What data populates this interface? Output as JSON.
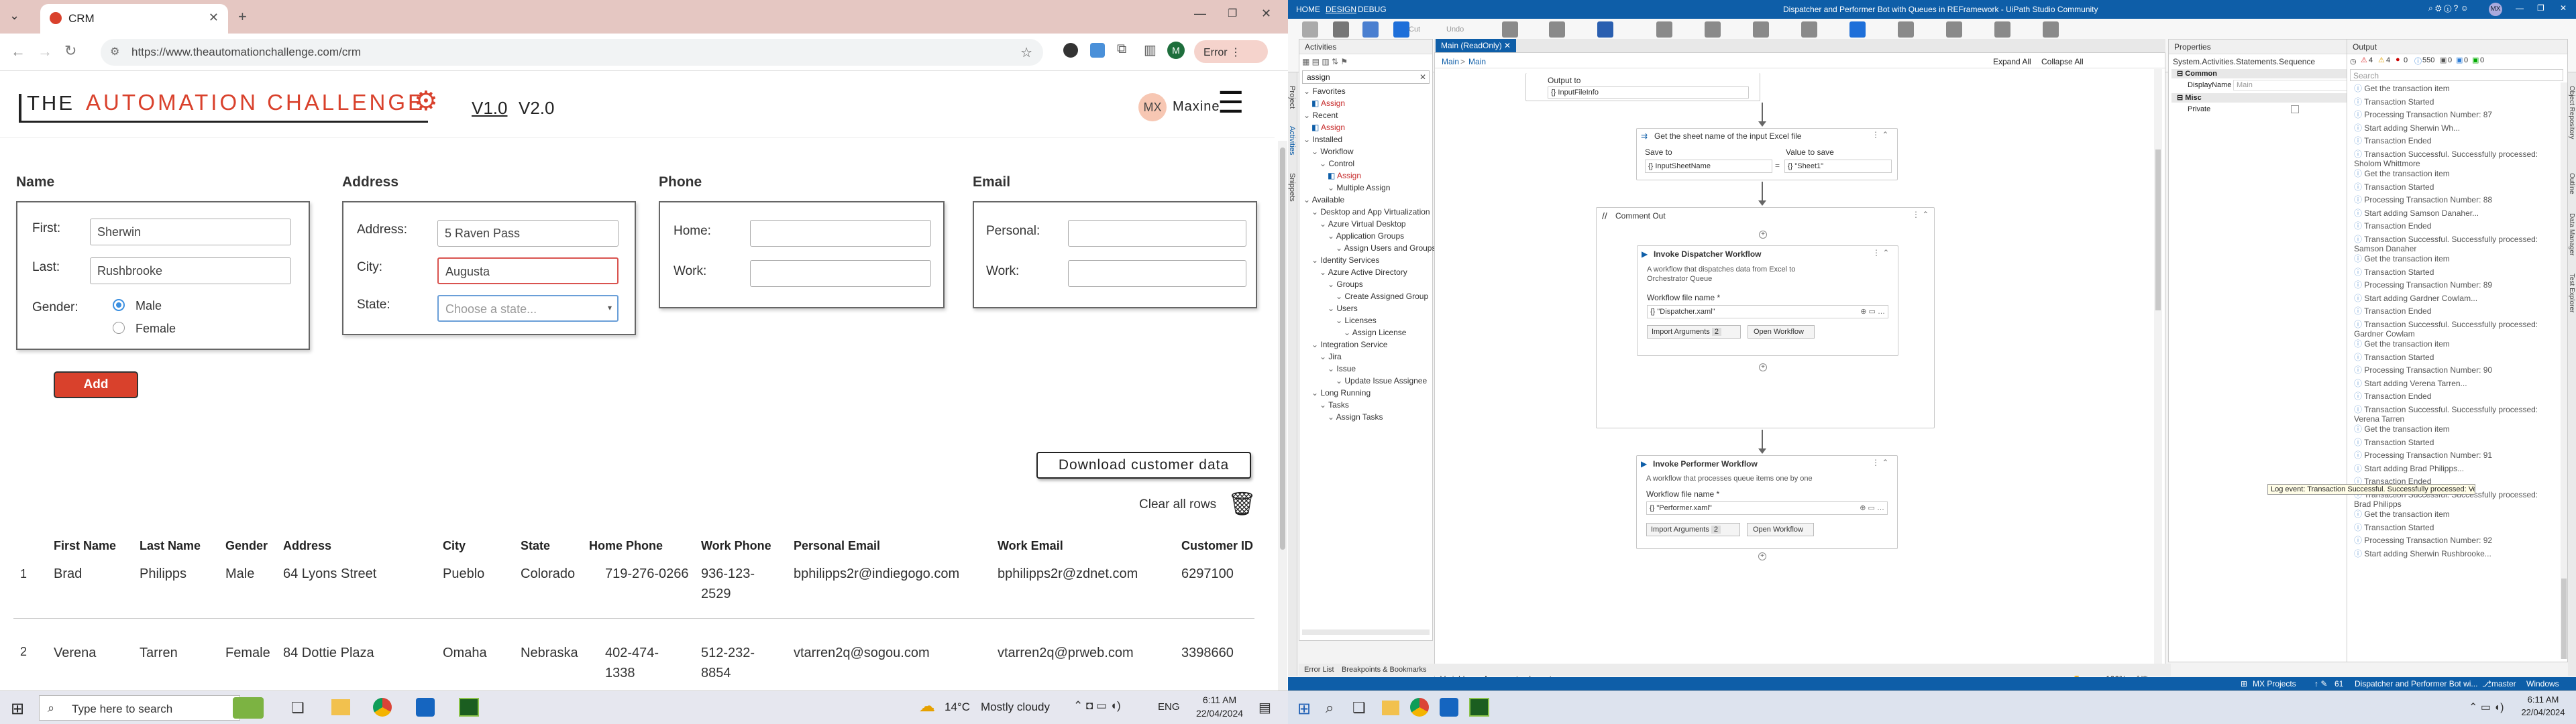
{
  "browser": {
    "tab_title": "CRM",
    "url": "https://www.theautomationchallenge.com/crm",
    "error_label": "Error",
    "profile_initial": "M",
    "icons": {
      "page_icon": "chili-icon",
      "new_tab": "plus-icon"
    }
  },
  "crm": {
    "brand_the": "THE",
    "brand_name": "AUTOMATION CHALLENGE",
    "version_1": "V1.0",
    "version_2": "V2.0",
    "user_initials": "MX",
    "user_name": "Maxine",
    "sections": {
      "name": "Name",
      "address": "Address",
      "phone": "Phone",
      "email": "Email"
    },
    "labels": {
      "first": "First:",
      "last": "Last:",
      "gender": "Gender:",
      "male": "Male",
      "female": "Female",
      "address": "Address:",
      "city": "City:",
      "state": "State:",
      "home": "Home:",
      "work": "Work:",
      "personal": "Personal:",
      "work_email": "Work:"
    },
    "values": {
      "first": "Sherwin",
      "last": "Rushbrooke",
      "address": "5 Raven Pass",
      "city": "Augusta",
      "state_placeholder": "Choose a state...",
      "home": "",
      "work": "",
      "personal": "",
      "work_email": ""
    },
    "add_button": "Add",
    "download_button": "Download customer data",
    "clear_rows": "Clear all rows",
    "table": {
      "columns": [
        "First Name",
        "Last Name",
        "Gender",
        "Address",
        "City",
        "State",
        "Home Phone",
        "Work Phone",
        "Personal Email",
        "Work Email",
        "Customer ID"
      ],
      "rows": [
        {
          "num": "1",
          "first": "Brad",
          "last": "Philipps",
          "gender": "Male",
          "address": "64 Lyons Street",
          "city": "Pueblo",
          "state": "Colorado",
          "home": "719-276-0266",
          "work": "936-123-\n2529",
          "personal": "bphilipps2r@indiegogo.com",
          "work_email": "bphilipps2r@zdnet.com",
          "id": "6297100"
        },
        {
          "num": "2",
          "first": "Verena",
          "last": "Tarren",
          "gender": "Female",
          "address": "84 Dottie Plaza",
          "city": "Omaha",
          "state": "Nebraska",
          "home": "402-474-\n1338",
          "work": "512-232-\n8854",
          "personal": "vtarren2q@sogou.com",
          "work_email": "vtarren2q@prweb.com",
          "id": "3398660"
        }
      ]
    }
  },
  "taskbar_left": {
    "search_placeholder": "Type here to search",
    "weather_temp": "14°C",
    "weather_desc": "Mostly cloudy",
    "lang": "ENG",
    "time": "6:11 AM",
    "date": "22/04/2024"
  },
  "studio": {
    "menu": [
      "HOME",
      "DESIGN",
      "DEBUG"
    ],
    "title": "Dispatcher and Performer Bot with Queues in REFramework - UiPath Studio Community",
    "ribbon": [
      {
        "label": "New"
      },
      {
        "label": "Save"
      },
      {
        "label": "Export\nAs"
      },
      {
        "label": "Stop"
      },
      {
        "label": "Manage\nPackages"
      },
      {
        "label": "Manage\nEntities"
      },
      {
        "label": "Test\nManager"
      },
      {
        "label": "App/Web\nRecorder"
      },
      {
        "label": "Computer\nVision"
      },
      {
        "label": "User\nEvents"
      },
      {
        "label": "Table\nExtraction"
      },
      {
        "label": "UI\nExplorer"
      },
      {
        "label": "Remove\nUnused"
      },
      {
        "label": "Analyze\nFile"
      },
      {
        "label": "Export\nto Excel"
      },
      {
        "label": "Publish"
      }
    ],
    "ribbon_small": [
      "Cut",
      "Copy",
      "Paste",
      "Undo",
      "Redo"
    ],
    "activities": {
      "title": "Activities",
      "search": "assign",
      "rows": [
        {
          "t": "Favorites",
          "lv": 0
        },
        {
          "t": "Assign",
          "lv": 1,
          "red": true
        },
        {
          "t": "Recent",
          "lv": 0
        },
        {
          "t": "Assign",
          "lv": 1,
          "red": true
        },
        {
          "t": "Installed",
          "lv": 0
        },
        {
          "t": "Workflow",
          "lv": 1
        },
        {
          "t": "Control",
          "lv": 2
        },
        {
          "t": "Assign",
          "lv": 3,
          "red": true
        },
        {
          "t": "Multiple Assign",
          "lv": 3
        },
        {
          "t": "Available",
          "lv": 0
        },
        {
          "t": "Desktop and App Virtualization",
          "lv": 1
        },
        {
          "t": "Azure Virtual Desktop",
          "lv": 2
        },
        {
          "t": "Application Groups",
          "lv": 3
        },
        {
          "t": "Assign Users and Groups to Applic",
          "lv": 4
        },
        {
          "t": "Identity Services",
          "lv": 1
        },
        {
          "t": "Azure Active Directory",
          "lv": 2
        },
        {
          "t": "Groups",
          "lv": 3
        },
        {
          "t": "Create Assigned Group",
          "lv": 4
        },
        {
          "t": "Users",
          "lv": 3
        },
        {
          "t": "Licenses",
          "lv": 4
        },
        {
          "t": "Assign License",
          "lv": 5
        },
        {
          "t": "Integration Service",
          "lv": 1
        },
        {
          "t": "Jira",
          "lv": 2
        },
        {
          "t": "Issue",
          "lv": 3
        },
        {
          "t": "Update Issue Assignee",
          "lv": 4
        },
        {
          "t": "Long Running",
          "lv": 1
        },
        {
          "t": "Tasks",
          "lv": 2
        },
        {
          "t": "Assign Tasks",
          "lv": 3
        }
      ]
    },
    "designer": {
      "tab": "Main (ReadOnly)",
      "breadcrumb": [
        "Main",
        "Main"
      ],
      "expand_all": "Expand All",
      "collapse_all": "Collapse All",
      "output_to": "Output to",
      "output_var": "InputFileInfo",
      "get_sheet": "Get the sheet name of the input Excel file",
      "save_to": "Save to",
      "value_to_save": "Value to save",
      "sheet_var": "InputSheetName",
      "sheet_val": "\"Sheet1\"",
      "comment_out": "Comment Out",
      "invoke_dispatcher": "Invoke Dispatcher Workflow",
      "dispatcher_desc": "A workflow that dispatches data from Excel to Orchestrator Queue",
      "wf_file_name": "Workflow file name *",
      "dispatcher_file": "\"Dispatcher.xaml\"",
      "import_args": "Import Arguments",
      "import_count": "2",
      "open_workflow": "Open Workflow",
      "invoke_performer": "Invoke Performer Workflow",
      "performer_desc": "A workflow that processes queue items one by one",
      "performer_file": "\"Performer.xaml\"",
      "bottom_tabs": [
        "Variables",
        "Arguments",
        "Imports"
      ],
      "zoom": "100%"
    },
    "properties": {
      "title": "Properties",
      "type": "System.Activities.Statements.Sequence",
      "common": "Common",
      "display_name_label": "DisplayName",
      "display_name_value": "Main",
      "misc": "Misc",
      "private_label": "Private"
    },
    "output": {
      "title": "Output",
      "counts": [
        "4",
        "4",
        "0",
        "550",
        "0",
        "0",
        "0"
      ],
      "search": "Search",
      "lines": [
        "Get the transaction item",
        "Transaction Started",
        "Processing Transaction Number: 87",
        "Start adding Sherwin Wh...",
        "Transaction Ended",
        "Transaction Successful. Successfully processed: Sholom Whittmore",
        "Get the transaction item",
        "Transaction Started",
        "Processing Transaction Number: 88",
        "Start adding Samson Danaher...",
        "Transaction Ended",
        "Transaction Successful. Successfully processed: Samson Danaher",
        "Get the transaction item",
        "Transaction Started",
        "Processing Transaction Number: 89",
        "Start adding Gardner Cowlam...",
        "Transaction Ended",
        "Transaction Successful. Successfully processed: Gardner Cowlam",
        "Get the transaction item",
        "Transaction Started",
        "Processing Transaction Number: 90",
        "Start adding Verena Tarren...",
        "Transaction Ended",
        "Transaction Successful. Successfully processed: Verena Tarren",
        "Get the transaction item",
        "Transaction Started",
        "Processing Transaction Number: 91",
        "Start adding Brad Philipps...",
        "Transaction Ended",
        "Transaction Successful. Successfully processed: Brad Philipps",
        "Get the transaction item",
        "Transaction Started",
        "Processing Transaction Number: 92",
        "Start adding Sherwin Rushbrooke..."
      ],
      "tooltip": "Log event: Transaction Successful. Successfully processed: Verena Tarren"
    },
    "side_tabs_left": [
      "Project",
      "Activities",
      "Snippets"
    ],
    "side_tabs_right": [
      "Object Repository",
      "Outline",
      "Data Manager",
      "Test Explorer"
    ],
    "bottom_left_tabs": [
      "Error List",
      "Breakpoints & Bookmarks"
    ],
    "status": {
      "project": "MX Projects",
      "counts": "61",
      "repo": "Dispatcher and Performer Bot wi...",
      "branch": "master",
      "platform": "Windows"
    },
    "taskbar_time": "6:11 AM",
    "taskbar_date": "22/04/2024"
  }
}
